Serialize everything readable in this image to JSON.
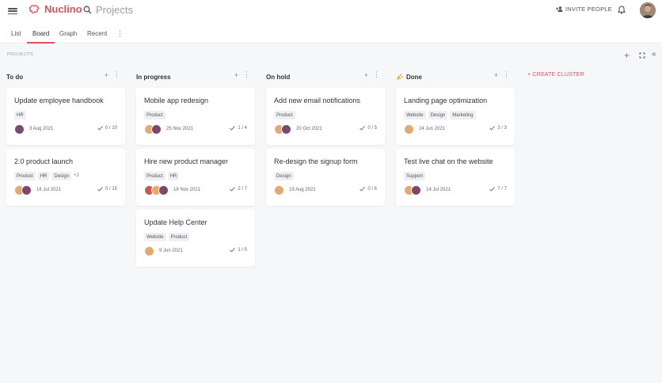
{
  "app": {
    "name": "Nuclino"
  },
  "search": {
    "placeholder": "Projects"
  },
  "header": {
    "invite_label": "INVITE PEOPLE"
  },
  "tabs": [
    {
      "label": "List",
      "active": false
    },
    {
      "label": "Board",
      "active": true
    },
    {
      "label": "Graph",
      "active": false
    },
    {
      "label": "Recent",
      "active": false
    }
  ],
  "board": {
    "label": "PROJECTS",
    "create_cluster_label": "+ CREATE CLUSTER"
  },
  "colors": {
    "accent": "#e2515a"
  },
  "columns": [
    {
      "title": "To do",
      "cards": [
        {
          "title": "Update employee handbook",
          "tags": [
            "HR"
          ],
          "extra_tags": "",
          "date": "3 Aug 2021",
          "progress": "0 / 10"
        },
        {
          "title": "2.0 product launch",
          "tags": [
            "Product",
            "HR",
            "Design"
          ],
          "extra_tags": "+2",
          "date": "16 Jul 2021",
          "progress": "0 / 15"
        }
      ]
    },
    {
      "title": "In progress",
      "cards": [
        {
          "title": "Mobile app redesign",
          "tags": [
            "Product"
          ],
          "extra_tags": "",
          "date": "25 Nov 2021",
          "progress": "1 / 4"
        },
        {
          "title": "Hire new product manager",
          "tags": [
            "Product",
            "HR"
          ],
          "extra_tags": "",
          "date": "18 Nov 2021",
          "progress": "2 / 7"
        },
        {
          "title": "Update Help Center",
          "tags": [
            "Website",
            "Product"
          ],
          "extra_tags": "",
          "date": "9 Jun 2021",
          "progress": "1 / 5"
        }
      ]
    },
    {
      "title": "On hold",
      "cards": [
        {
          "title": "Add new email notifications",
          "tags": [
            "Product"
          ],
          "extra_tags": "",
          "date": "20 Oct 2021",
          "progress": "0 / 5"
        },
        {
          "title": "Re-design the signup form",
          "tags": [
            "Design"
          ],
          "extra_tags": "",
          "date": "19 Aug 2021",
          "progress": "0 / 6"
        }
      ]
    },
    {
      "title": "Done",
      "cards": [
        {
          "title": "Landing page optimization",
          "tags": [
            "Website",
            "Design",
            "Marketing"
          ],
          "extra_tags": "",
          "date": "24 Jun 2021",
          "progress": "3 / 3"
        },
        {
          "title": "Test live chat on the website",
          "tags": [
            "Support"
          ],
          "extra_tags": "",
          "date": "14 Jul 2021",
          "progress": "7 / 7"
        }
      ]
    }
  ]
}
